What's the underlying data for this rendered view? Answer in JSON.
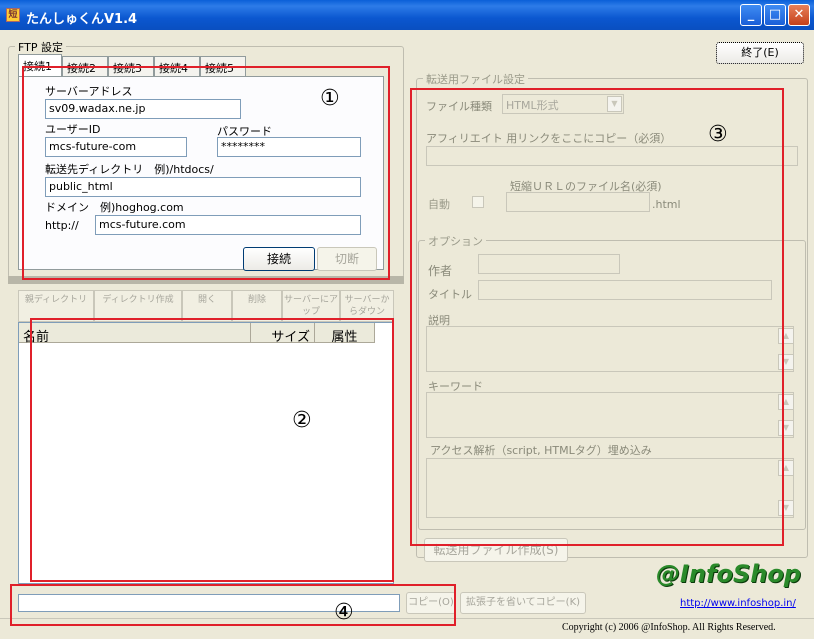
{
  "window": {
    "title": "たんしゅくんV1.4",
    "close_label": "終了(E)"
  },
  "ftp": {
    "group_label": "FTP 設定",
    "tabs": [
      "接続1",
      "接続2",
      "接続3",
      "接続4",
      "接続5"
    ],
    "server_label": "サーバーアドレス",
    "server_value": "sv09.wadax.ne.jp",
    "user_label": "ユーザーID",
    "user_value": "mcs-future-com",
    "password_label": "パスワード",
    "password_value": "********",
    "dir_label": "転送先ディレクトリ　例)/htdocs/",
    "dir_value": "public_html",
    "domain_label": "ドメイン　例)hoghog.com",
    "domain_prefix": "http://",
    "domain_value": "mcs-future.com",
    "connect_label": "接続",
    "disconnect_label": "切断"
  },
  "toolbar": [
    "親ディレクトリ",
    "ディレクトリ作成",
    "開く",
    "削除",
    "サーバーにアップ",
    "サーバーからダウン"
  ],
  "filelist": {
    "columns": [
      "名前",
      "サイズ",
      "属性"
    ]
  },
  "transfer": {
    "group_label": "転送用ファイル設定",
    "filetype_label": "ファイル種類",
    "filetype_value": "HTML形式",
    "affiliate_label": "アフィリエイト 用リンクをここにコピー（必須）",
    "short_url_label": "短縮ＵＲＬのファイル名(必須)",
    "auto_label": "自動",
    "html_ext": ".html"
  },
  "options": {
    "group_label": "オプション",
    "author_label": "作者",
    "title_label": "タイトル",
    "desc_label": "説明",
    "keyword_label": "キーワード",
    "analytics_label": "アクセス解析（script, HTMLタグ）埋め込み",
    "create_label": "転送用ファイル作成(S)"
  },
  "bottom": {
    "copy_label": "コピー(O)",
    "copy_noext_label": "拡張子を省いてコピー(K)",
    "logo_text": "@InfoShop",
    "logo_url": "http://www.infoshop.in/",
    "copyright": "Copyright (c) 2006 @InfoShop. All Rights Reserved."
  },
  "annotations": [
    "①",
    "②",
    "③",
    "④"
  ]
}
